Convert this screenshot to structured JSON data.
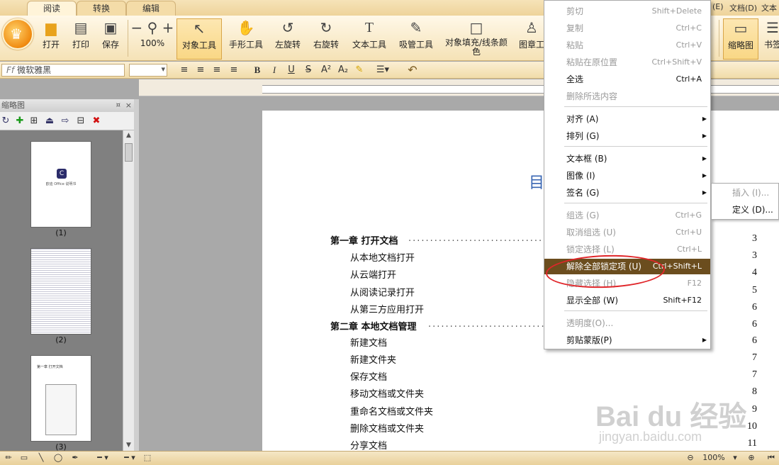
{
  "tabs": [
    {
      "label": "阅读"
    },
    {
      "label": "转换"
    },
    {
      "label": "编辑"
    }
  ],
  "top_right": {
    "item1": "(E)",
    "item2": "文档(D)",
    "item3": "文本"
  },
  "ribbon": {
    "open": "打开",
    "print": "打印",
    "save": "保存",
    "zoom": "100%",
    "object_tool": "对象工具",
    "hand_tool": "手形工具",
    "rotate_left": "左旋转",
    "rotate_right": "右旋转",
    "text_tool": "文本工具",
    "eyedropper": "吸管工具",
    "fill_stroke": "对象填充/线条颜色",
    "stamp_tool": "图章工",
    "thumbnail": "缩略图",
    "bookmark": "书签"
  },
  "format_bar": {
    "font_name": "微软雅黑"
  },
  "thumbnail_panel": {
    "title": "缩略图",
    "pages": [
      {
        "label": "(1)"
      },
      {
        "label": "(2)"
      },
      {
        "label": "(3)"
      }
    ],
    "page1_text": "欧迪 Office 说明书",
    "page3_text": "第一章 打开文档"
  },
  "document": {
    "toc_title": "目",
    "entries": [
      {
        "text": "第一章  打开文档",
        "page": "3",
        "type": "chapter"
      },
      {
        "text": "从本地文档打开",
        "page": "3",
        "type": "section"
      },
      {
        "text": "从云端打开",
        "page": "4",
        "type": "section"
      },
      {
        "text": "从阅读记录打开",
        "page": "5",
        "type": "section"
      },
      {
        "text": "从第三方应用打开",
        "page": "6",
        "type": "section"
      },
      {
        "text": "第二章  本地文档管理",
        "page": "6",
        "type": "chapter"
      },
      {
        "text": "新建文档",
        "page": "6",
        "type": "section"
      },
      {
        "text": "新建文件夹",
        "page": "7",
        "type": "section"
      },
      {
        "text": "保存文档",
        "page": "7",
        "type": "section"
      },
      {
        "text": "移动文档或文件夹",
        "page": "8",
        "type": "section"
      },
      {
        "text": "重命名文档或文件夹",
        "page": "9",
        "type": "section"
      },
      {
        "text": "删除文档或文件夹",
        "page": "10",
        "type": "section"
      },
      {
        "text": "分享文档",
        "page": "11",
        "type": "section"
      }
    ],
    "dots": "................................................................"
  },
  "context_menu": {
    "items": [
      {
        "label": "剪切",
        "shortcut": "Shift+Delete",
        "enabled": false
      },
      {
        "label": "复制",
        "shortcut": "Ctrl+C",
        "enabled": false
      },
      {
        "label": "粘贴",
        "shortcut": "Ctrl+V",
        "enabled": false
      },
      {
        "label": "粘贴在原位置",
        "shortcut": "Ctrl+Shift+V",
        "enabled": false
      },
      {
        "label": "全选",
        "shortcut": "Ctrl+A",
        "enabled": true
      },
      {
        "label": "删除所选内容",
        "shortcut": "",
        "enabled": false
      },
      {
        "label": "对齐 (A)",
        "shortcut": "",
        "enabled": true,
        "submenu": true
      },
      {
        "label": "排列 (G)",
        "shortcut": "",
        "enabled": true,
        "submenu": true
      },
      {
        "label": "文本框 (B)",
        "shortcut": "",
        "enabled": true,
        "submenu": true
      },
      {
        "label": "图像 (I)",
        "shortcut": "",
        "enabled": true,
        "submenu": true
      },
      {
        "label": "签名 (G)",
        "shortcut": "",
        "enabled": true,
        "submenu": true
      },
      {
        "label": "组选 (G)",
        "shortcut": "Ctrl+G",
        "enabled": false
      },
      {
        "label": "取消组选 (U)",
        "shortcut": "Ctrl+U",
        "enabled": false
      },
      {
        "label": "锁定选择 (L)",
        "shortcut": "Ctrl+L",
        "enabled": false
      },
      {
        "label": "解除全部锁定项 (U)",
        "shortcut": "Ctrl+Shift+L",
        "enabled": true,
        "highlighted": true
      },
      {
        "label": "隐藏选择 (H)",
        "shortcut": "F12",
        "enabled": false
      },
      {
        "label": "显示全部 (W)",
        "shortcut": "Shift+F12",
        "enabled": true
      },
      {
        "label": "透明度(O)...",
        "shortcut": "",
        "enabled": false
      },
      {
        "label": "剪贴蒙版(P)",
        "shortcut": "",
        "enabled": true,
        "submenu": true
      }
    ]
  },
  "submenu": {
    "items": [
      {
        "label": "插入 (I)...",
        "enabled": false
      },
      {
        "label": "定义 (D)...",
        "enabled": true
      }
    ]
  },
  "status_bar": {
    "zoom": "100%"
  },
  "watermark": {
    "line1": "Bai du 经验",
    "line2": "jingyan.baidu.com"
  },
  "colors": {
    "highlight": "#6b4d1e",
    "annotation": "#e0262a",
    "toc_title": "#3a67b3"
  }
}
